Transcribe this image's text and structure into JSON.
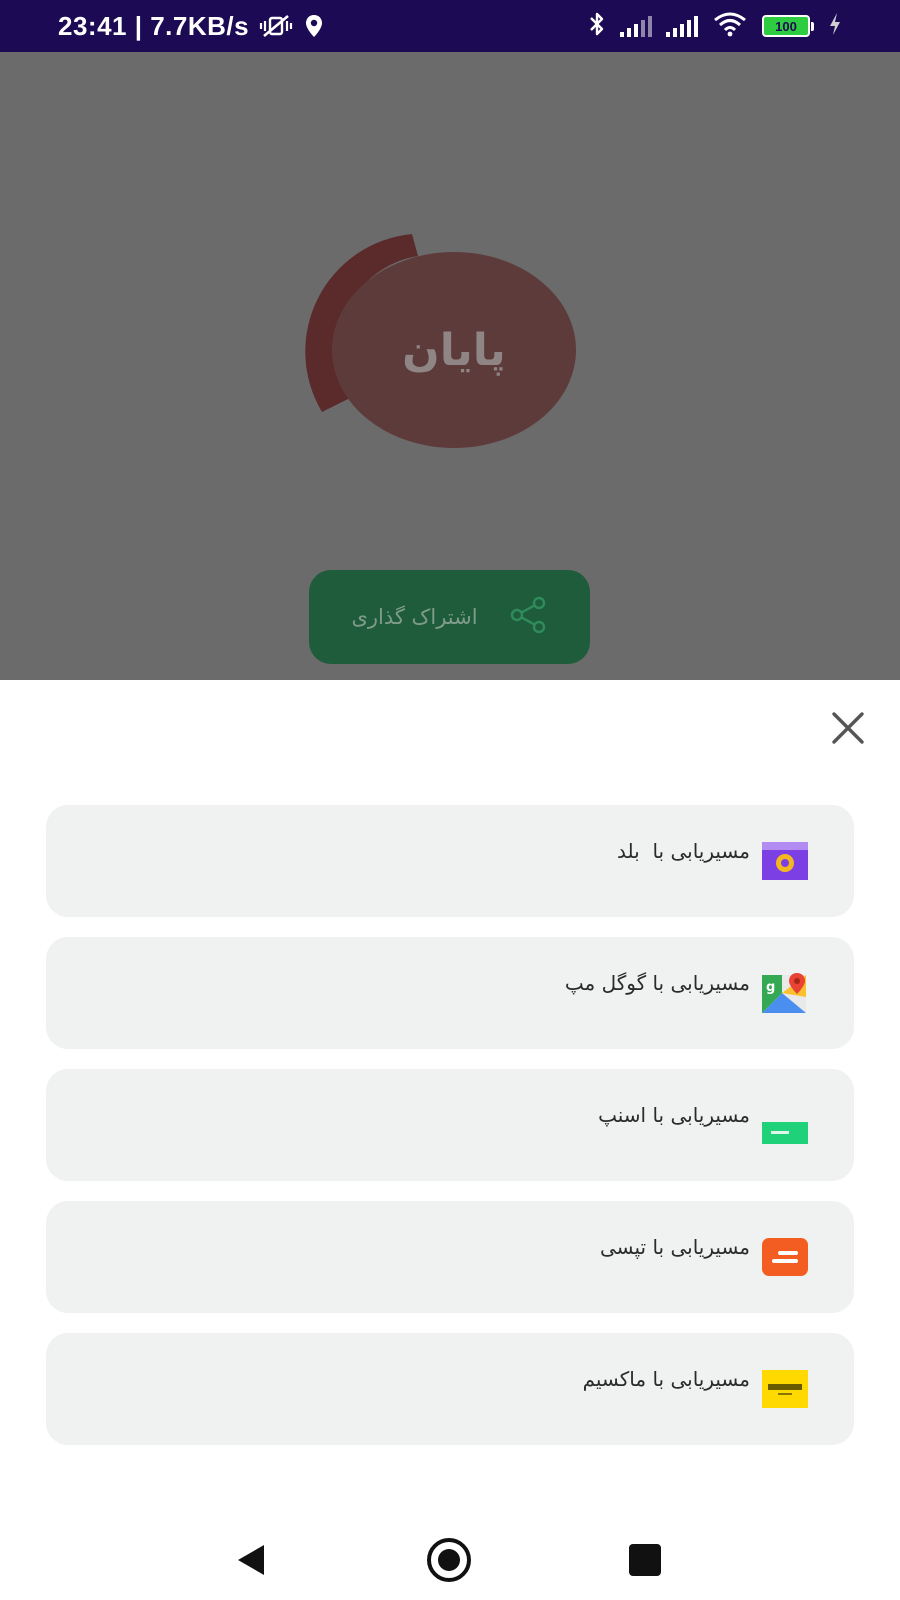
{
  "status_bar": {
    "time_speed": "23:41 | 7.7KB/s",
    "battery_level": "100"
  },
  "background": {
    "end_button_label": "پایان",
    "share_button_label": "اشتراک گذاری"
  },
  "sheet": {
    "options": [
      {
        "label": "مسیریابی با  بلد",
        "icon": "balad-icon"
      },
      {
        "label": "مسیریابی با گوگل مپ",
        "icon": "google-maps-icon"
      },
      {
        "label": "مسیریابی با اسنپ",
        "icon": "snapp-icon"
      },
      {
        "label": "مسیریابی با تپسی",
        "icon": "tapsi-icon"
      },
      {
        "label": "مسیریابی با ماکسیم",
        "icon": "maxim-icon"
      }
    ]
  },
  "colors": {
    "status_bar_bg": "#1c0a54",
    "backdrop": "#6b6b6b",
    "end_circle": "#5e3b3b",
    "share_button": "#1f5c3b",
    "option_bg": "#f0f1f1"
  }
}
